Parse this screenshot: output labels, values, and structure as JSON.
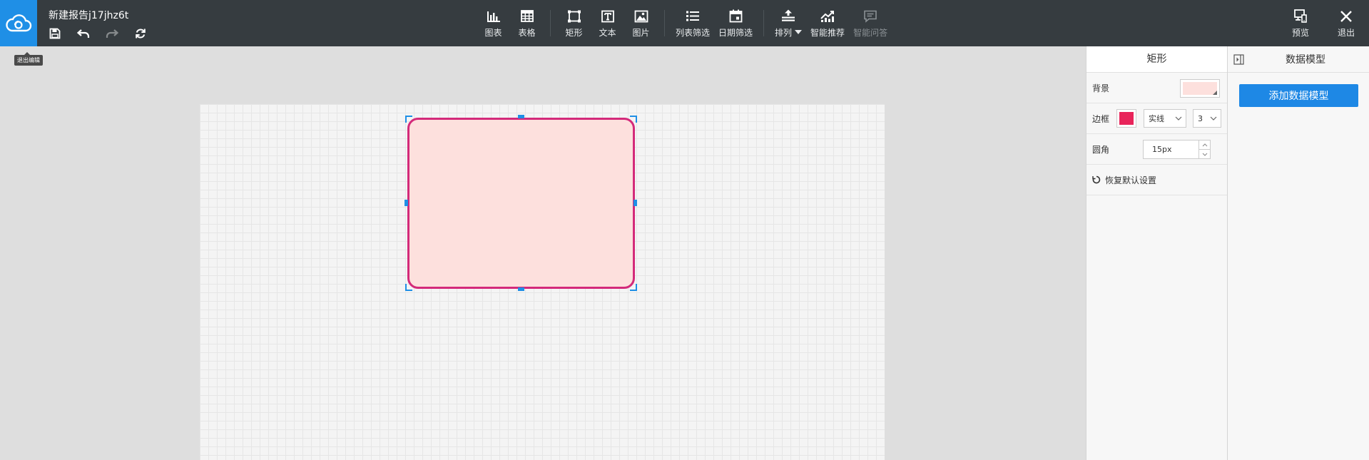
{
  "header": {
    "title": "新建报告j17jhz6t",
    "logo_tooltip": "退出编辑"
  },
  "quick_actions": [
    {
      "name": "save",
      "icon": "save-icon"
    },
    {
      "name": "undo",
      "icon": "undo-icon"
    },
    {
      "name": "redo",
      "icon": "redo-icon",
      "disabled": true
    },
    {
      "name": "refresh",
      "icon": "refresh-icon"
    }
  ],
  "toolbar": {
    "chart": "图表",
    "table": "表格",
    "rect": "矩形",
    "text": "文本",
    "image": "图片",
    "list_filter": "列表筛选",
    "date_filter": "日期筛选",
    "arrange": "排列",
    "smart_recommend": "智能推荐",
    "smart_qa": "智能问答",
    "preview": "预览",
    "exit": "退出"
  },
  "props": {
    "title": "矩形",
    "background_label": "背景",
    "background_color": "#fde0dd",
    "border_label": "边框",
    "border_color": "#e8245a",
    "border_style": "实线",
    "border_width": "3",
    "radius_label": "圆角",
    "radius_value": "15px",
    "reset_label": "恢复默认设置"
  },
  "data_model": {
    "title": "数据模型",
    "add_button": "添加数据模型"
  },
  "colors": {
    "accent": "#1f8fe6",
    "topbar": "#363c40",
    "rect_fill": "#fde0dd",
    "rect_border": "#d42a7a"
  }
}
